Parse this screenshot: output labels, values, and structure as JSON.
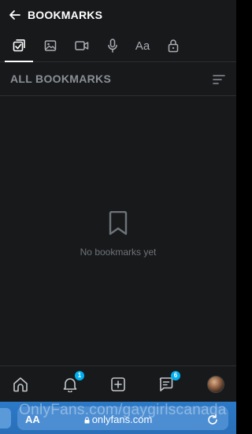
{
  "header": {
    "back_icon": "arrow-left-icon",
    "title": "BOOKMARKS"
  },
  "tabs": [
    {
      "id": "all",
      "icon": "check-square-icon",
      "active": true
    },
    {
      "id": "photos",
      "icon": "image-icon",
      "active": false
    },
    {
      "id": "videos",
      "icon": "video-icon",
      "active": false
    },
    {
      "id": "audio",
      "icon": "microphone-icon",
      "active": false
    },
    {
      "id": "text",
      "icon": "text-icon",
      "label": "Aa",
      "active": false
    },
    {
      "id": "locked",
      "icon": "lock-icon",
      "active": false
    }
  ],
  "section": {
    "title": "ALL BOOKMARKS",
    "sort_icon": "sort-lines-icon"
  },
  "empty_state": {
    "icon": "bookmark-icon",
    "message": "No bookmarks yet"
  },
  "bottom_nav": {
    "items": [
      {
        "id": "home",
        "icon": "home-icon"
      },
      {
        "id": "notifications",
        "icon": "bell-icon",
        "badge": "1"
      },
      {
        "id": "add",
        "icon": "plus-square-icon"
      },
      {
        "id": "messages",
        "icon": "message-icon",
        "badge": "6"
      },
      {
        "id": "profile",
        "icon": "avatar"
      }
    ]
  },
  "browser": {
    "aa_label": "AA",
    "url": "onlyfans.com",
    "watermark": "OnlyFans.com/gaygirlscanada",
    "reload_icon": "reload-icon",
    "lock_icon": "lock-icon"
  },
  "colors": {
    "background": "#18191b",
    "divider": "#2c2e31",
    "accent": "#00aff0",
    "muted_text": "#8a9096",
    "browser_bar": "#2b79c7"
  }
}
